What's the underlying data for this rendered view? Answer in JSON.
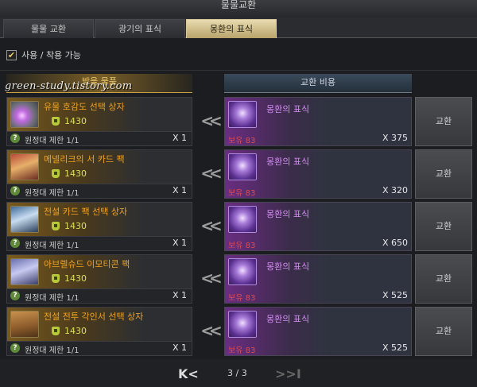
{
  "window": {
    "title": "물물교환"
  },
  "tabs": [
    {
      "label": "물물 교환",
      "active": false
    },
    {
      "label": "광기의 표식",
      "active": false
    },
    {
      "label": "몽환의 표식",
      "active": true
    }
  ],
  "filter": {
    "label": "사용 / 착용 가능",
    "checked": true
  },
  "columns": {
    "reward": "받을 물품",
    "cost": "교환 비용"
  },
  "watermark": "green-study.tistory.com",
  "rows": [
    {
      "name": "유물 호감도 선택 상자",
      "price": "1430",
      "limit": "원정대 제한 1/1",
      "qty": "X 1",
      "cost_name": "몽환의 표식",
      "owned": "보유 83",
      "cost_qty": "X 375",
      "button": "교환",
      "icon": "gift-box-icon"
    },
    {
      "name": "메넬리크의 서 카드 팩",
      "price": "1430",
      "limit": "원정대 제한 1/1",
      "qty": "X 1",
      "cost_name": "몽환의 표식",
      "owned": "보유 83",
      "cost_qty": "X 320",
      "button": "교환",
      "icon": "card-pack-icon"
    },
    {
      "name": "전설 카드 팩 선택 상자",
      "price": "1430",
      "limit": "원정대 제한 1/1",
      "qty": "X 1",
      "cost_name": "몽환의 표식",
      "owned": "보유 83",
      "cost_qty": "X 650",
      "button": "교환",
      "icon": "card-pack-icon"
    },
    {
      "name": "아브렐슈드 이모티콘 팩",
      "price": "1430",
      "limit": "원정대 제한 1/1",
      "qty": "X 1",
      "cost_name": "몽환의 표식",
      "owned": "보유 83",
      "cost_qty": "X 525",
      "button": "교환",
      "icon": "emoticon-pack-icon"
    },
    {
      "name": "전설 전투 각인서 선택 상자",
      "price": "1430",
      "limit": "원정대 제한 1/1",
      "qty": "X 1",
      "cost_name": "몽환의 표식",
      "owned": "보유 83",
      "cost_qty": "X 525",
      "button": "교환",
      "icon": "satchel-icon"
    }
  ],
  "pager": {
    "first": "K<",
    "page": "3 / 3",
    "last": ">>I"
  },
  "colors": {
    "reward_name": "#f0a21e",
    "cost_name": "#d28cf0",
    "owned": "#e0494d",
    "price": "#d8e05a",
    "active_tab": "#d8c89a"
  }
}
